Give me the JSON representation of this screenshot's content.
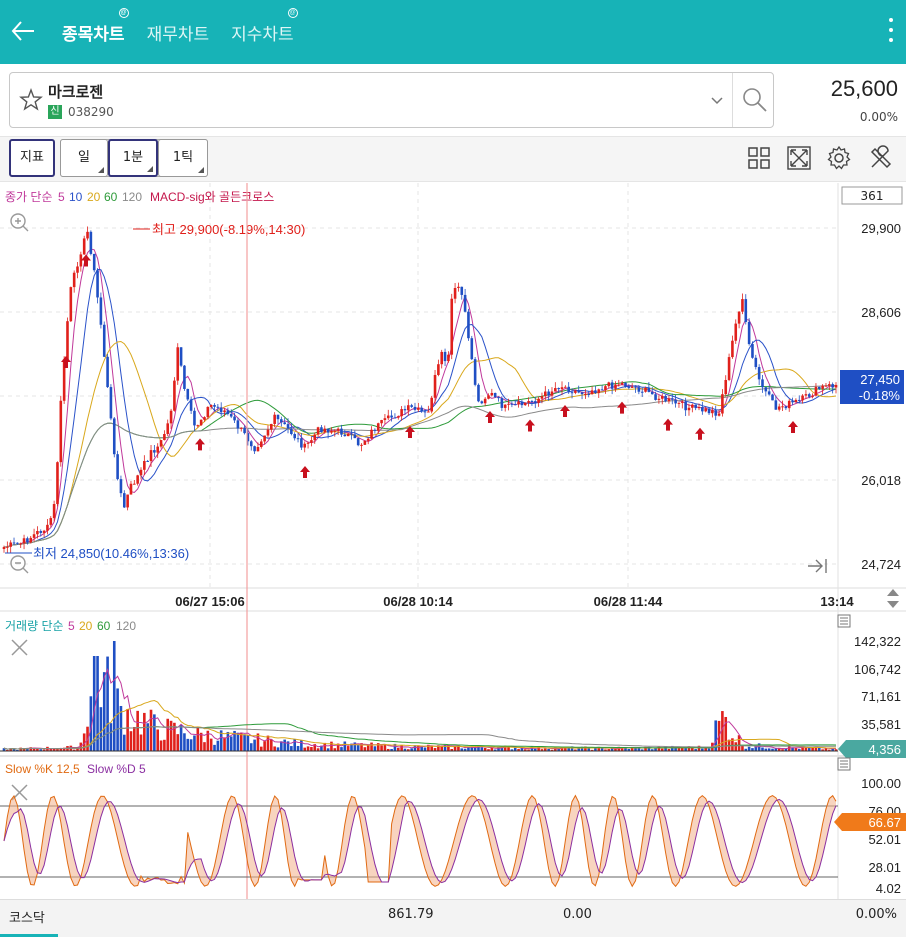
{
  "topbar": {
    "tabs": [
      {
        "label": "종목차트",
        "active": true,
        "marker": true
      },
      {
        "label": "재무차트",
        "active": false,
        "marker": false
      },
      {
        "label": "지수차트",
        "active": false,
        "marker": true
      }
    ]
  },
  "stock": {
    "name": "마크로젠",
    "badge": "신",
    "code": "038290",
    "price": "25,600",
    "change_pct": "0.00%"
  },
  "toolbar": {
    "indicator_label": "지표",
    "period_day": "일",
    "period_minute": "1분",
    "period_tick": "1틱"
  },
  "price_panel": {
    "legend": {
      "prefix": "종가 단순",
      "ma": [
        {
          "label": "5",
          "color": "#c0399b"
        },
        {
          "label": "10",
          "color": "#2a52c9"
        },
        {
          "label": "20",
          "color": "#d9a81c"
        },
        {
          "label": "60",
          "color": "#2e9b3a"
        },
        {
          "label": "120",
          "color": "#8a8a8a"
        }
      ],
      "signal": "MACD-sig와 골든크로스"
    },
    "count_box": "361",
    "y_ticks": [
      "29,900",
      "28,606",
      "26,018",
      "24,724"
    ],
    "high_label": "최고 29,900(-8.19%,14:30)",
    "low_label": "최저 24,850(10.46%,13:36)",
    "current_price": "27,450",
    "current_change": "-0.18%",
    "x_ticks": [
      "06/27 15:06",
      "06/28 10:14",
      "06/28 11:44",
      "13:14"
    ]
  },
  "volume_panel": {
    "legend": {
      "prefix": "거래량 단순",
      "ma": [
        {
          "label": "5",
          "color": "#c0399b"
        },
        {
          "label": "20",
          "color": "#d9a81c"
        },
        {
          "label": "60",
          "color": "#2e9b3a"
        },
        {
          "label": "120",
          "color": "#8a8a8a"
        }
      ]
    },
    "y_ticks": [
      "142,322",
      "106,742",
      "71,161",
      "35,581"
    ],
    "current": "4,356"
  },
  "stoch_panel": {
    "legend_k": "Slow %K 12,5",
    "legend_d": "Slow %D 5",
    "y_ticks": [
      "100.00",
      "76.00",
      "52.01",
      "28.01",
      "4.02"
    ],
    "current": "66.67"
  },
  "colors": {
    "brand": "#17b3b7",
    "up": "#e0201b",
    "down": "#1f4fc4",
    "cursor_line": "#f2a0a0"
  },
  "footer": {
    "index_name": "코스닥",
    "index_value": "861.79",
    "index_change": "0.00",
    "index_pct": "0.00%"
  }
}
